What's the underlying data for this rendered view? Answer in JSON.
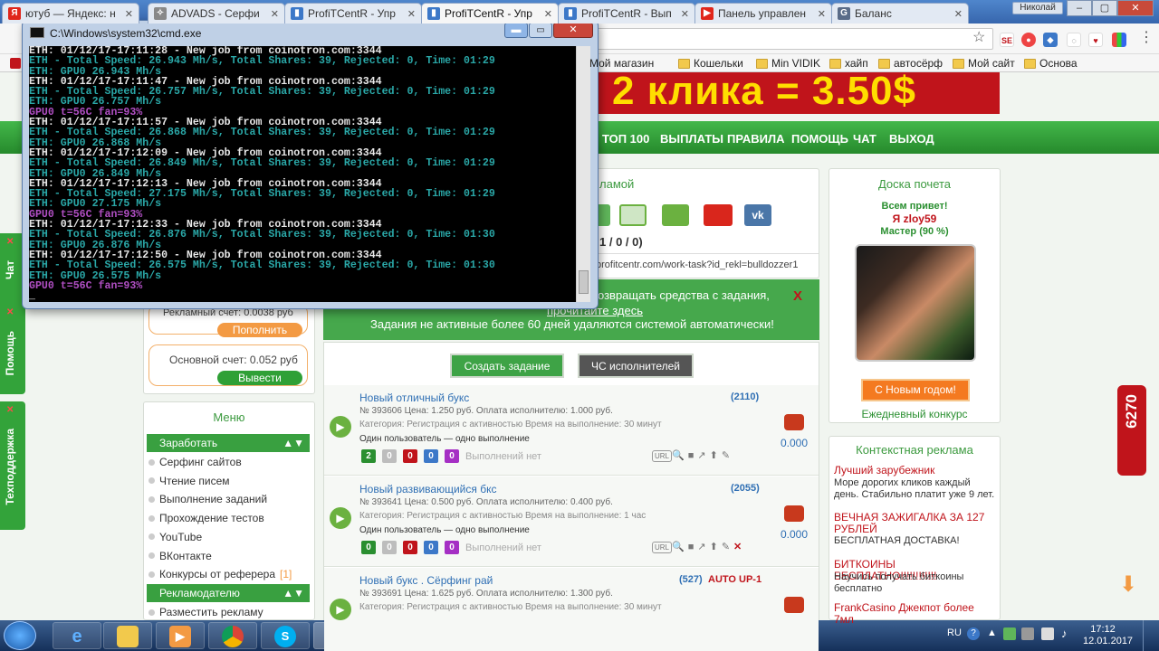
{
  "browser": {
    "tabs": [
      {
        "title": "ютуб — Яндекс: н",
        "favicon": "Я",
        "color": "#e0261b",
        "active": false
      },
      {
        "title": "ADVADS - Серфи",
        "favicon": "✧",
        "color": "#888888",
        "active": false
      },
      {
        "title": "ProfiTCentR - Упр",
        "favicon": "▮",
        "color": "#3c78c8",
        "active": false
      },
      {
        "title": "ProfiTCentR - Упр",
        "favicon": "▮",
        "color": "#3c78c8",
        "active": true
      },
      {
        "title": "ProfiTCentR - Вып",
        "favicon": "▮",
        "color": "#3c78c8",
        "active": false
      },
      {
        "title": "Панель управлен",
        "favicon": "▶",
        "color": "#e0261b",
        "active": false
      },
      {
        "title": "Баланс",
        "favicon": "G",
        "color": "#5a6c88",
        "active": false
      }
    ],
    "user": "Николай",
    "bookmarks": [
      "Мой магазин",
      "Кошельки",
      "Min VIDIK",
      "хайп",
      "автосёрф",
      "Мой сайт",
      "Основа"
    ]
  },
  "site": {
    "banner": "2 клика = 3.50$",
    "nav": [
      "ТОП 100",
      "ВЫПЛАТЫ",
      "ПРАВИЛА",
      "ПОМОЩЬ",
      "ЧАТ",
      "ВЫХОД"
    ],
    "ad_panel_head_fragment": "ламой",
    "ad_stats_fragment": "1 / 0 / 0)",
    "ad_url": "profitcentr.com/work-task?id_rekl=bulldozzer1",
    "notice_line1_fragment": "озвращать средства с задания,",
    "notice_line1_underlined": "прочитайте здесь",
    "notice_line2": "Задания не активные более 60 дней удаляются системой автоматически!",
    "notice_close": "X",
    "create_task_btn": "Создать задание",
    "blacklist_btn": "ЧС исполнителей",
    "tasks": [
      {
        "title": "Новый отличный букс",
        "count": "(2110)",
        "autoup": "",
        "number": "№ 393606",
        "price": "Цена: 1.250 руб.",
        "payout": "Оплата исполнителю: 1.000 руб.",
        "category": "Категория: Регистрация с активностью",
        "duration": "Время на выполнение: 30 минут",
        "user_limit": "Один пользователь — одно выполнение",
        "counters": [
          "2",
          "0",
          "0",
          "0",
          "0"
        ],
        "status": "Выполнений нет",
        "balance": "0.000"
      },
      {
        "title": "Новый развивающийся бкс",
        "count": "(2055)",
        "autoup": "",
        "number": "№ 393641",
        "price": "Цена: 0.500 руб.",
        "payout": "Оплата исполнителю: 0.400 руб.",
        "category": "Категория: Регистрация с активностью",
        "duration": "Время на выполнение: 1 час",
        "user_limit": "Один пользователь — одно выполнение",
        "counters": [
          "0",
          "0",
          "0",
          "0",
          "0"
        ],
        "status": "Выполнений нет",
        "balance": "0.000"
      },
      {
        "title": "Новый букс . Сёрфинг рай",
        "count": "(527)",
        "autoup": "AUTO UP-1",
        "number": "№ 393691",
        "price": "Цена: 1.625 руб.",
        "payout": "Оплата исполнителю: 1.300 руб.",
        "category": "Категория: Регистрация с активностью",
        "duration": "Время на выполнение: 30 минут",
        "user_limit": "",
        "counters": [],
        "status": "",
        "balance": ""
      }
    ],
    "url_label": "URL",
    "account": {
      "ad_balance_label": "Рекламный счет: 0.0038 руб",
      "topup_btn": "Пополнить",
      "main_balance_label": "Основной счет: 0.052 руб",
      "withdraw_btn": "Вывести"
    },
    "menu": {
      "title": "Меню",
      "section1": "Заработать",
      "items": [
        "Серфинг сайтов",
        "Чтение писем",
        "Выполнение заданий",
        "Прохождение тестов",
        "YouTube",
        "ВКонтакте",
        "Конкурсы от реферера"
      ],
      "contest_badge": "[1]",
      "section2": "Рекламодателю",
      "items2": [
        "Разместить рекламу"
      ]
    },
    "side_tabs": [
      "Чат",
      "Помощь",
      "Техподдержка"
    ],
    "honor": {
      "title": "Доска почета",
      "greeting": "Всем привет!",
      "user": "Я zloy59",
      "rank": "Мастер (90 %)",
      "newyear_btn": "С Новым годом!",
      "daily_contest": "Ежедневный конкурс"
    },
    "context_ads": {
      "title": "Контекстная реклама",
      "items": [
        {
          "link": "Лучший зарубежник",
          "text": "Море дорогих кликов каждый день. Стабильно платит уже 9 лет."
        },
        {
          "link": "ВЕЧНАЯ ЗАЖИГАЛКА ЗА 127 РУБЛЕЙ",
          "text": "БЕСПЛАТНАЯ ДОСТАВКА!"
        },
        {
          "link": "БИТКОИНЫ БЕСПЛАТНО!!!!!!!!!!!!",
          "text": "Научись получать биткоины бесплатно"
        },
        {
          "link": "FrankCasino Джекпот более 7мл",
          "text": ""
        }
      ]
    },
    "badge_6270": "6270"
  },
  "cmd": {
    "title": "C:\\Windows\\system32\\cmd.exe",
    "lines": [
      {
        "t": "ETH: 01/12/17-17:11:28 - New job from coinotron.com:3344",
        "c": "w"
      },
      {
        "t": "ETH - Total Speed: 26.943 Mh/s, Total Shares: 39, Rejected: 0, Time: 01:29",
        "c": "c"
      },
      {
        "t": "ETH: GPU0 26.943 Mh/s",
        "c": "c"
      },
      {
        "t": "ETH: 01/12/17-17:11:47 - New job from coinotron.com:3344",
        "c": "w"
      },
      {
        "t": "ETH - Total Speed: 26.757 Mh/s, Total Shares: 39, Rejected: 0, Time: 01:29",
        "c": "c"
      },
      {
        "t": "ETH: GPU0 26.757 Mh/s",
        "c": "c"
      },
      {
        "t": "GPU0 t=56C fan=93%",
        "c": "m"
      },
      {
        "t": "ETH: 01/12/17-17:11:57 - New job from coinotron.com:3344",
        "c": "w"
      },
      {
        "t": "ETH - Total Speed: 26.868 Mh/s, Total Shares: 39, Rejected: 0, Time: 01:29",
        "c": "c"
      },
      {
        "t": "ETH: GPU0 26.868 Mh/s",
        "c": "c"
      },
      {
        "t": "ETH: 01/12/17-17:12:09 - New job from coinotron.com:3344",
        "c": "w"
      },
      {
        "t": "ETH - Total Speed: 26.849 Mh/s, Total Shares: 39, Rejected: 0, Time: 01:29",
        "c": "c"
      },
      {
        "t": "ETH: GPU0 26.849 Mh/s",
        "c": "c"
      },
      {
        "t": "ETH: 01/12/17-17:12:13 - New job from coinotron.com:3344",
        "c": "w"
      },
      {
        "t": "ETH - Total Speed: 27.175 Mh/s, Total Shares: 39, Rejected: 0, Time: 01:29",
        "c": "c"
      },
      {
        "t": "ETH: GPU0 27.175 Mh/s",
        "c": "c"
      },
      {
        "t": "GPU0 t=56C fan=93%",
        "c": "m"
      },
      {
        "t": "ETH: 01/12/17-17:12:33 - New job from coinotron.com:3344",
        "c": "w"
      },
      {
        "t": "ETH - Total Speed: 26.876 Mh/s, Total Shares: 39, Rejected: 0, Time: 01:30",
        "c": "c"
      },
      {
        "t": "ETH: GPU0 26.876 Mh/s",
        "c": "c"
      },
      {
        "t": "ETH: 01/12/17-17:12:50 - New job from coinotron.com:3344",
        "c": "w"
      },
      {
        "t": "ETH - Total Speed: 26.575 Mh/s, Total Shares: 39, Rejected: 0, Time: 01:30",
        "c": "c"
      },
      {
        "t": "ETH: GPU0 26.575 Mh/s",
        "c": "c"
      },
      {
        "t": "GPU0 t=56C fan=93%",
        "c": "m"
      }
    ],
    "colors": {
      "w": "#e8e8e8",
      "c": "#2aa8a8",
      "m": "#b14fc4"
    }
  },
  "taskbar": {
    "lang": "RU",
    "time": "17:12",
    "date": "12.01.2017"
  }
}
